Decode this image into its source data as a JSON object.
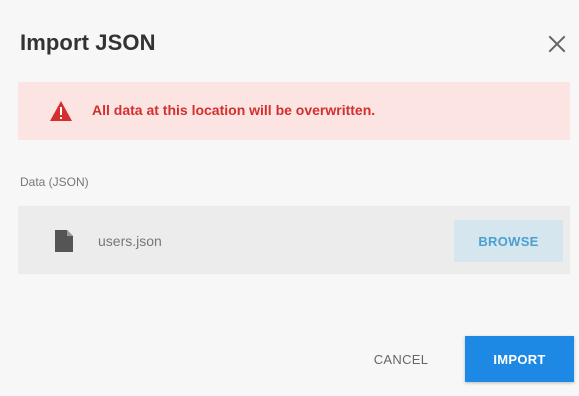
{
  "dialog": {
    "title": "Import JSON",
    "close_icon": "close-icon"
  },
  "warning": {
    "icon": "warning-icon",
    "text": "All data at this location will be overwritten.",
    "color": "#d32f2f",
    "background": "#fbe4e2"
  },
  "field": {
    "label": "Data (JSON)",
    "file_icon": "file-icon",
    "file_name": "users.json",
    "browse_label": "BROWSE"
  },
  "actions": {
    "cancel_label": "CANCEL",
    "import_label": "IMPORT",
    "import_color": "#1e88e5"
  }
}
